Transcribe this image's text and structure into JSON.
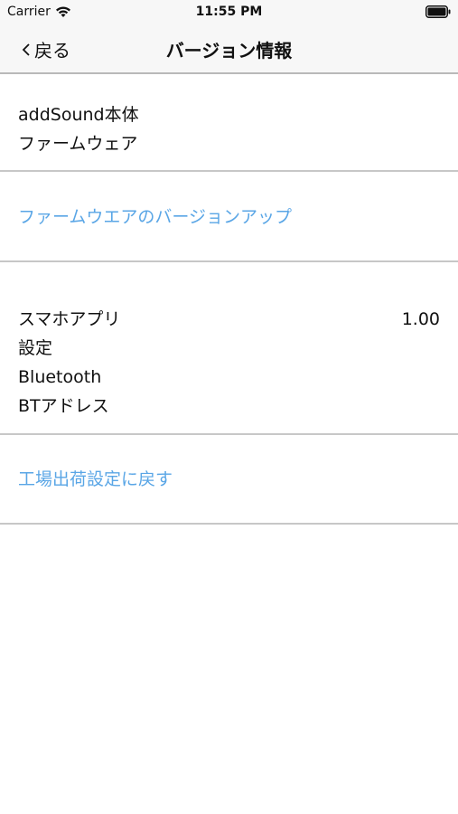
{
  "status_bar": {
    "carrier": "Carrier",
    "time": "11:55 PM"
  },
  "nav": {
    "back_label": "戻る",
    "title": "バージョン情報"
  },
  "device_section": {
    "items": [
      {
        "label": "addSound本体"
      },
      {
        "label": "ファームウェア"
      }
    ]
  },
  "firmware_update_link": "ファームウエアのバージョンアップ",
  "info_section": {
    "items": [
      {
        "label": "スマホアプリ",
        "value": "1.00"
      },
      {
        "label": "設定"
      },
      {
        "label": "Bluetooth"
      },
      {
        "label": "BTアドレス"
      }
    ]
  },
  "factory_reset_link": "工場出荷設定に戻す",
  "colors": {
    "link": "#5aa6e6",
    "bar_background": "#f7f7f7",
    "divider": "#c7c7c7"
  }
}
